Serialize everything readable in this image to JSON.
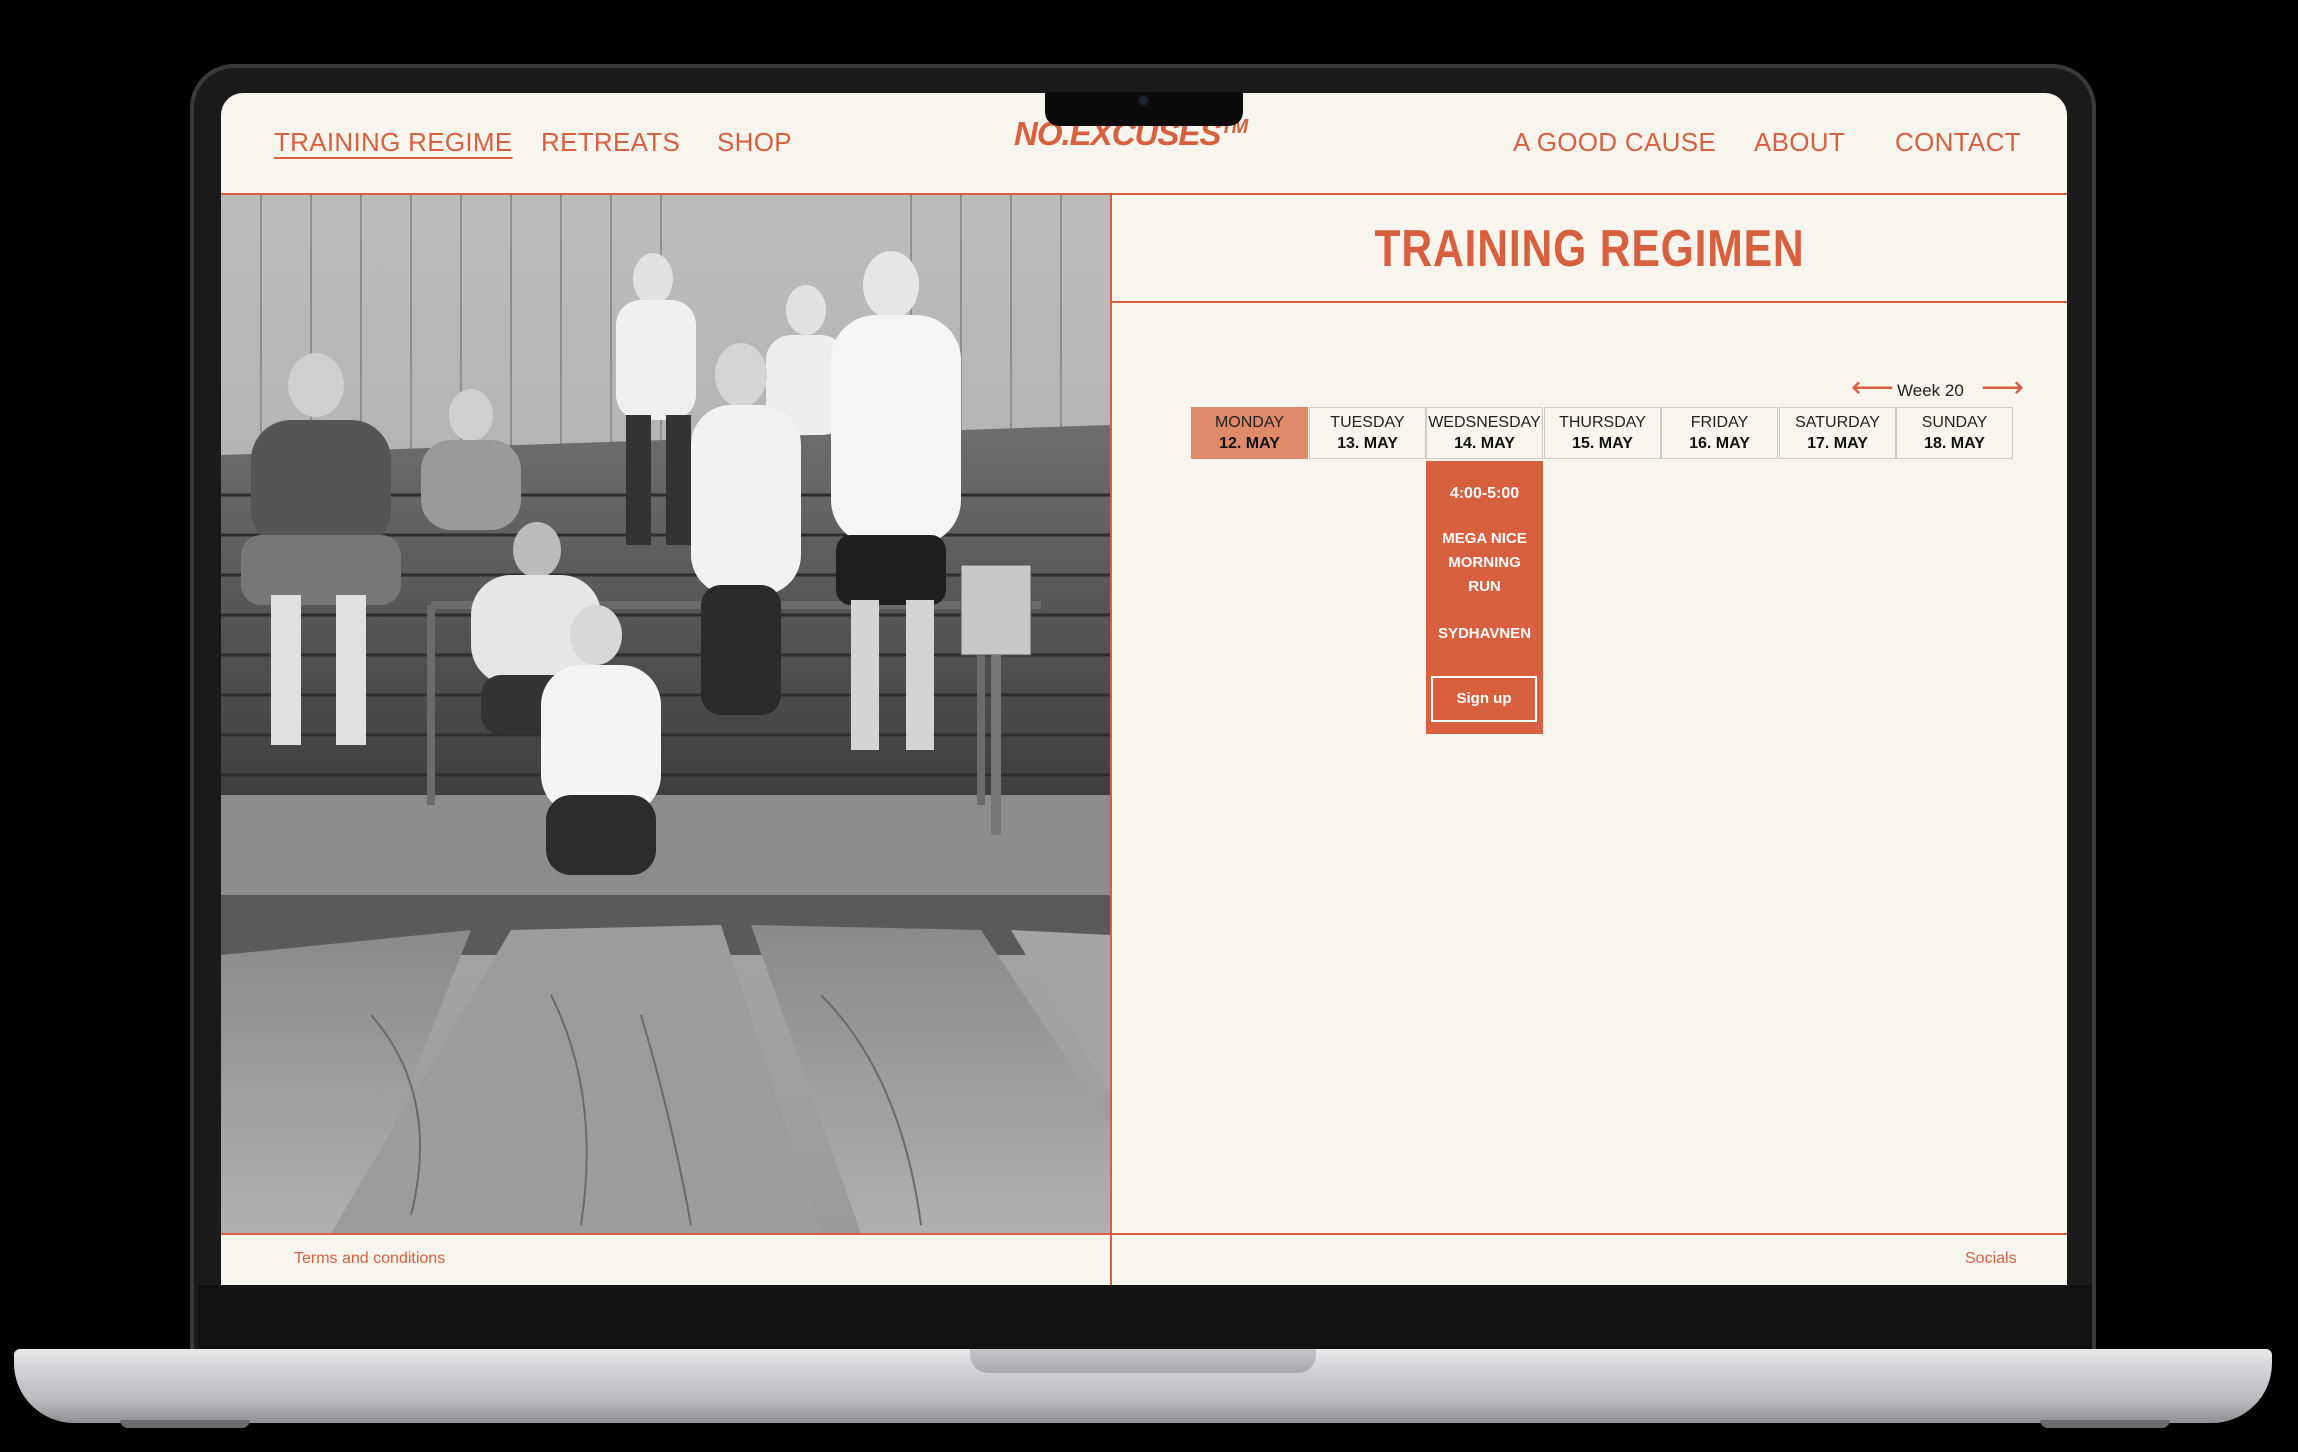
{
  "nav": {
    "left": [
      "TRAINING REGIME",
      "RETREATS",
      "SHOP"
    ],
    "right": [
      "A GOOD CAUSE",
      "ABOUT",
      "CONTACT"
    ],
    "logo": "NO.EXCUSES",
    "logo_mark": "TM"
  },
  "page_title": "TRAINING REGIMEN",
  "week": {
    "label": "Week 20",
    "prev_arrow": "⟵",
    "next_arrow": "⟶"
  },
  "days": [
    {
      "name": "MONDAY",
      "date": "12. MAY",
      "selected": true
    },
    {
      "name": "TUESDAY",
      "date": "13. MAY",
      "selected": false
    },
    {
      "name": "WEDSNESDAY",
      "date": "14. MAY",
      "selected": false
    },
    {
      "name": "THURSDAY",
      "date": "15. MAY",
      "selected": false
    },
    {
      "name": "FRIDAY",
      "date": "16. MAY",
      "selected": false
    },
    {
      "name": "SATURDAY",
      "date": "17. MAY",
      "selected": false
    },
    {
      "name": "SUNDAY",
      "date": "18. MAY",
      "selected": false
    }
  ],
  "event": {
    "day": "WEDSNESDAY",
    "time": "4:00-5:00",
    "name": "MEGA NICE MORNING RUN",
    "location": "SYDHAVNEN",
    "button": "Sign up"
  },
  "footer": {
    "left": "Terms and conditions",
    "right": "Socials"
  },
  "colors": {
    "accent": "#d8603e",
    "selected_day": "#df8a6a",
    "background": "#f8f4ee"
  }
}
